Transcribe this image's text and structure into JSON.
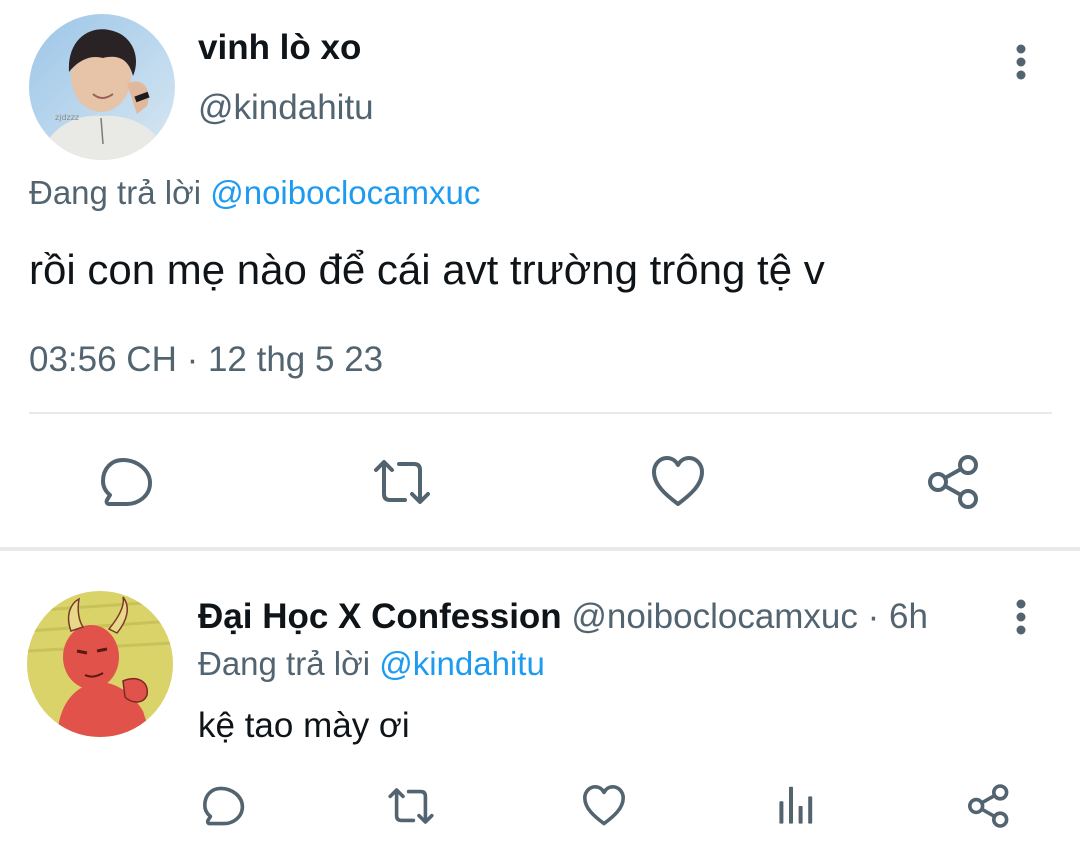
{
  "main_tweet": {
    "display_name": "vinh lò xo",
    "handle": "@kindahitu",
    "reply_context_prefix": "Đang trả lời",
    "reply_context_mention": "@noiboclocamxuc",
    "text": "rồi con mẹ nào để cái avt trường trông tệ v",
    "timestamp": "03:56 CH · 12 thg 5 23",
    "avatar_watermark": "zjdzzz",
    "actions": [
      "reply-icon",
      "retweet-icon",
      "like-icon",
      "share-icon"
    ]
  },
  "reply_tweet": {
    "display_name": "Đại Học X Confession",
    "handle_time": "@noiboclocamxuc · 6h",
    "reply_context_prefix": "Đang trả lời",
    "reply_context_mention": "@kindahitu",
    "text": "kệ tao mày ơi",
    "actions": [
      "reply-icon",
      "retweet-icon",
      "like-icon",
      "analytics-icon",
      "share-icon"
    ]
  },
  "colors": {
    "text_primary": "#0f1419",
    "text_secondary": "#536471",
    "link": "#1d9bf0",
    "icon": "#536471",
    "divider": "#e7e9ea",
    "reply_avatar_bg": "#d9d36a",
    "reply_avatar_figure": "#e0524a"
  }
}
